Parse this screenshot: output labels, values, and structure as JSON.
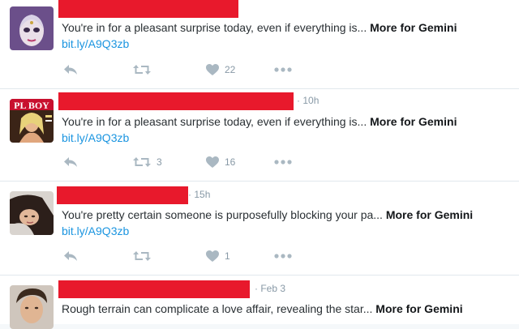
{
  "tweets": [
    {
      "time": "",
      "text": "You're in for a pleasant surprise today, even if everything is...",
      "more": "More for Gemini",
      "link": "bit.ly/A9Q3zb",
      "retweets": "",
      "likes": "22"
    },
    {
      "time": "10h",
      "text": "You're in for a pleasant surprise today, even if everything is...",
      "more": "More for Gemini",
      "link": "bit.ly/A9Q3zb",
      "retweets": "3",
      "likes": "16"
    },
    {
      "time": "15h",
      "text": "You're pretty certain someone is purposefully blocking your pa...",
      "more": "More for Gemini",
      "link": "bit.ly/A9Q3zb",
      "retweets": "",
      "likes": "1"
    },
    {
      "time": "Feb 3",
      "text": "Rough terrain can complicate a love affair, revealing the star...",
      "more": "More for Gemini",
      "link": "",
      "retweets": "",
      "likes": ""
    }
  ],
  "icons": {
    "reply": "reply-icon",
    "retweet": "retweet-icon",
    "like": "heart-icon",
    "more": "more-dots-icon"
  },
  "colors": {
    "redaction": "#e8192c",
    "link": "#1b95e0",
    "muted": "#8899a6",
    "icon": "#aab8c2"
  }
}
